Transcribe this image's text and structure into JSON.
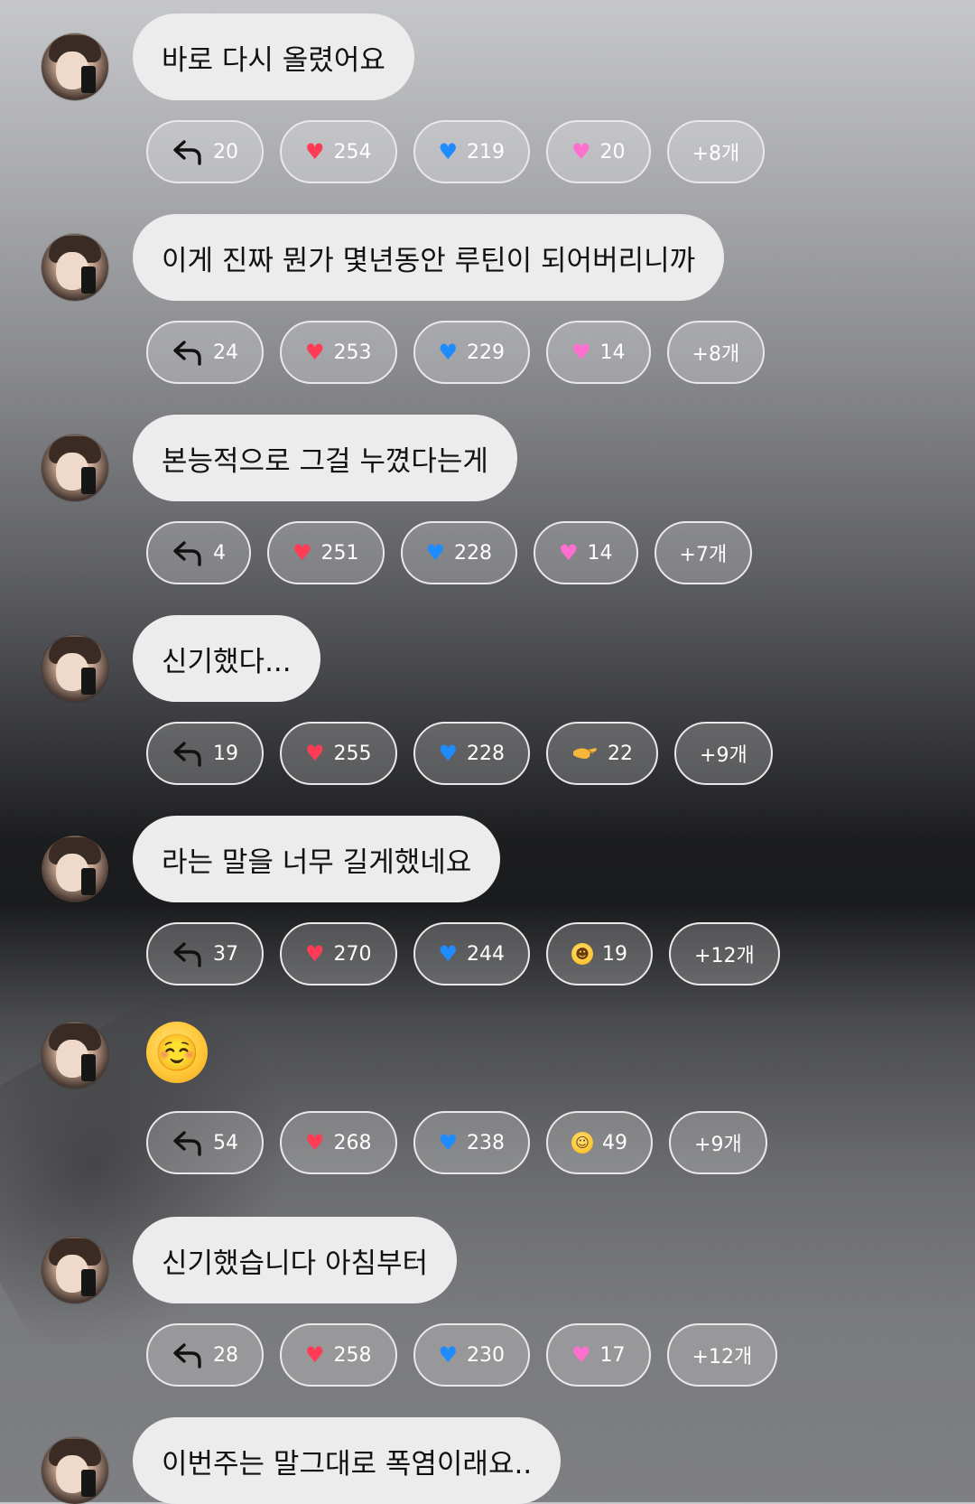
{
  "colors": {
    "bubble_bg": "#ececec",
    "pill_border": "#e9e9e9",
    "heart_red": "#ff3b56",
    "heart_blue": "#1e8bff",
    "heart_pink": "#ff6fcf"
  },
  "messages": [
    {
      "text": "바로 다시 올렸어요",
      "reactions": {
        "reply": "20",
        "red": "254",
        "blue": "219",
        "third_icon": "pink-heart",
        "third": "20",
        "more": "+8개"
      }
    },
    {
      "text": "이게 진짜 뭔가 몇년동안 루틴이 되어버리니까",
      "reactions": {
        "reply": "24",
        "red": "253",
        "blue": "229",
        "third_icon": "pink-heart",
        "third": "14",
        "more": "+8개"
      }
    },
    {
      "text": "본능적으로 그걸 누꼈다는게",
      "reactions": {
        "reply": "4",
        "red": "251",
        "blue": "228",
        "third_icon": "pink-heart",
        "third": "14",
        "more": "+7개"
      }
    },
    {
      "text": "신기했다...",
      "reactions": {
        "reply": "19",
        "red": "255",
        "blue": "228",
        "third_icon": "pinching-hand",
        "third": "22",
        "more": "+9개"
      }
    },
    {
      "text": "라는 말을 너무 길게했네요",
      "reactions": {
        "reply": "37",
        "red": "270",
        "blue": "244",
        "third_icon": "laughing-face",
        "third": "19",
        "more": "+12개"
      }
    },
    {
      "text": "☺️",
      "reactions": {
        "reply": "54",
        "red": "268",
        "blue": "238",
        "third_icon": "smiling-face",
        "third": "49",
        "more": "+9개"
      }
    },
    {
      "text": "신기했습니다 아침부터",
      "reactions": {
        "reply": "28",
        "red": "258",
        "blue": "230",
        "third_icon": "pink-heart",
        "third": "17",
        "more": "+12개"
      }
    },
    {
      "text": "이번주는 말그대로 폭염이래요..",
      "reactions": null
    }
  ]
}
